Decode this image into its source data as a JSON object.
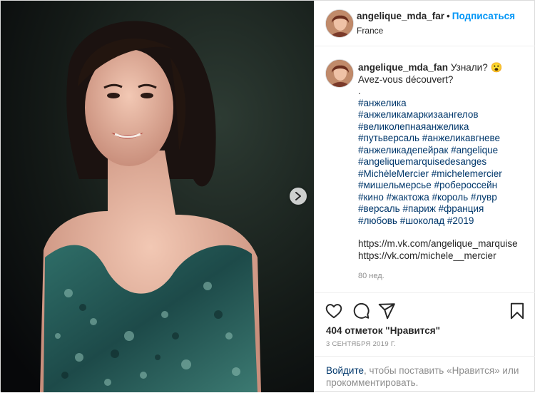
{
  "header": {
    "username": "angelique_mda_far",
    "separator": "•",
    "follow_label": "Подписаться",
    "location": "France"
  },
  "caption": {
    "username": "angelique_mda_fan",
    "text_line1": "Узнали? 😮",
    "text_line2": "Avez-vous découvert?",
    "dot": ".",
    "hashtag_lines": [
      "#анжелика",
      "#анжеликамаркизаангелов",
      "#великолепнаяанжелика",
      "#путьверсаль #анжеликавгневе",
      "#анжеликадепейрак #angelique",
      "#angeliquemarquisedesanges",
      "#MichèleMercier #michelemercier",
      "#мишельмерсье #робероссейн",
      "#кино #жактожа #король #лувр",
      "#версаль #париж #франция",
      "#любовь #шоколад #2019"
    ],
    "links": [
      "https://m.vk.com/angelique_marquise",
      "https://vk.com/michele__mercier"
    ],
    "time_ago": "80 нед."
  },
  "actions": {
    "icons": [
      "heart-icon",
      "comment-icon",
      "share-icon",
      "bookmark-icon"
    ],
    "likes_text": "404 отметок \"Нравится\"",
    "date": "3 СЕНТЯБРЯ 2019 Г.",
    "login_link": "Войдите",
    "login_rest": ", чтобы поставить «Нравится» или прокомментировать."
  },
  "colors": {
    "link_blue": "#0095f6",
    "hashtag": "#00376b",
    "muted": "#8e8e8e",
    "border": "#dbdbdb"
  }
}
